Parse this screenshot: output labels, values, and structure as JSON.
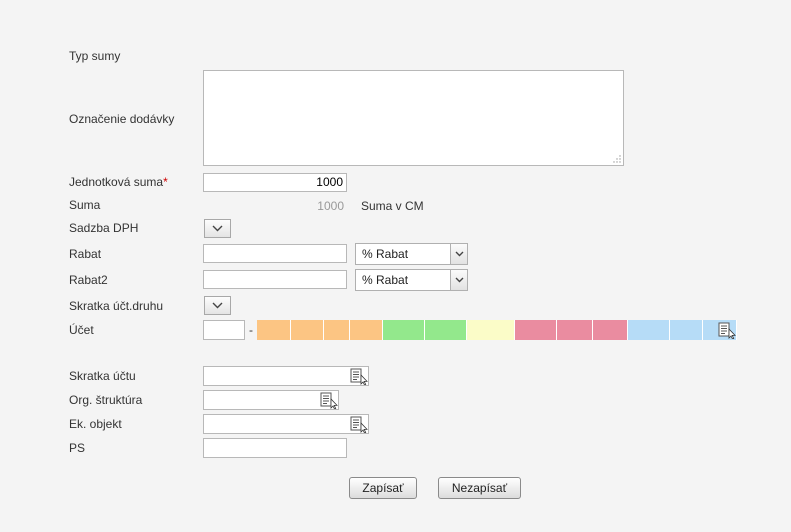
{
  "form": {
    "typ_sumy": {
      "label": "Typ sumy"
    },
    "oznacenie": {
      "label": "Označenie dodávky",
      "value": ""
    },
    "jednotkova_suma": {
      "label": "Jednotková suma",
      "required_mark": "*",
      "value": "1000"
    },
    "suma": {
      "label": "Suma",
      "value": "1000",
      "note": "Suma v CM"
    },
    "sadzba_dph": {
      "label": "Sadzba DPH"
    },
    "rabat": {
      "label": "Rabat",
      "value": "",
      "type_selected": "% Rabat"
    },
    "rabat2": {
      "label": "Rabat2",
      "value": "",
      "type_selected": "% Rabat"
    },
    "skratka_uct_druhu": {
      "label": "Skratka účt.druhu"
    },
    "ucet": {
      "label": "Účet",
      "prefix": "",
      "separator": "-",
      "segments": [
        {
          "color": "#fcc583",
          "w": 34
        },
        {
          "color": "#fcc583",
          "w": 33
        },
        {
          "color": "#fcc583",
          "w": 26
        },
        {
          "color": "#fcc583",
          "w": 33
        },
        {
          "color": "#93e88c",
          "w": 42
        },
        {
          "color": "#93e88c",
          "w": 42
        },
        {
          "color": "#fbfcc8",
          "w": 48
        },
        {
          "color": "#ea8ca0",
          "w": 42
        },
        {
          "color": "#ea8ca0",
          "w": 36
        },
        {
          "color": "#ea8ca0",
          "w": 35
        },
        {
          "color": "#b6dcf7",
          "w": 42
        },
        {
          "color": "#b6dcf7",
          "w": 33
        },
        {
          "color": "#b6dcf7",
          "w": 34
        }
      ]
    },
    "skratka_uctu": {
      "label": "Skratka účtu",
      "value": ""
    },
    "org_struktura": {
      "label": "Org. štruktúra",
      "value": ""
    },
    "ek_objekt": {
      "label": "Ek. objekt",
      "value": ""
    },
    "ps": {
      "label": "PS",
      "value": ""
    }
  },
  "buttons": {
    "save": "Zapísať",
    "cancel": "Nezapísať"
  },
  "icons": {
    "dropdown": "chevron-down-icon",
    "lookup": "lookup-list-icon"
  }
}
